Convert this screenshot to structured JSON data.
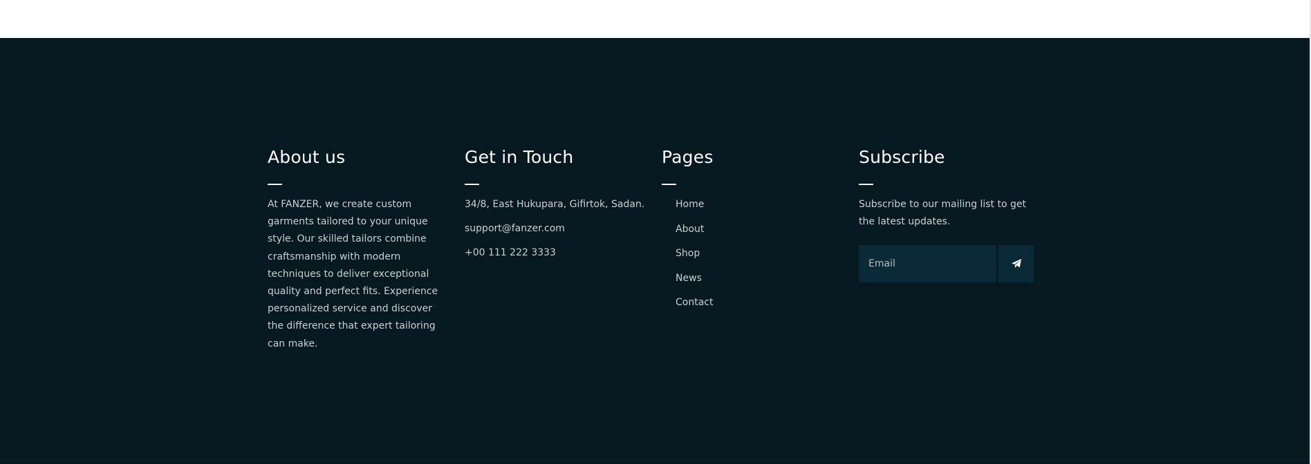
{
  "footer": {
    "about": {
      "title": "About us",
      "text": "At FANZER, we create custom garments tailored to your unique style. Our skilled tailors combine craftsmanship with modern techniques to deliver exceptional quality and perfect fits. Experience personalized service and discover the difference that expert tailoring can make."
    },
    "contact": {
      "title": "Get in Touch",
      "address": "34/8, East Hukupara, Gifirtok, Sadan.",
      "email": "support@fanzer.com",
      "phone": "+00 111 222 3333"
    },
    "pages": {
      "title": "Pages",
      "items": [
        {
          "label": "Home"
        },
        {
          "label": "About"
        },
        {
          "label": "Shop"
        },
        {
          "label": "News"
        },
        {
          "label": "Contact"
        }
      ]
    },
    "subscribe": {
      "title": "Subscribe",
      "text": "Subscribe to our mailing list to get the latest updates.",
      "email_placeholder": "Email",
      "email_value": "",
      "submit_icon": "paper-plane-icon"
    }
  },
  "colors": {
    "footer_background": "#061921",
    "input_background": "#0a2a38",
    "heading": "#ffffff",
    "body_text": "#c9d0d4"
  }
}
